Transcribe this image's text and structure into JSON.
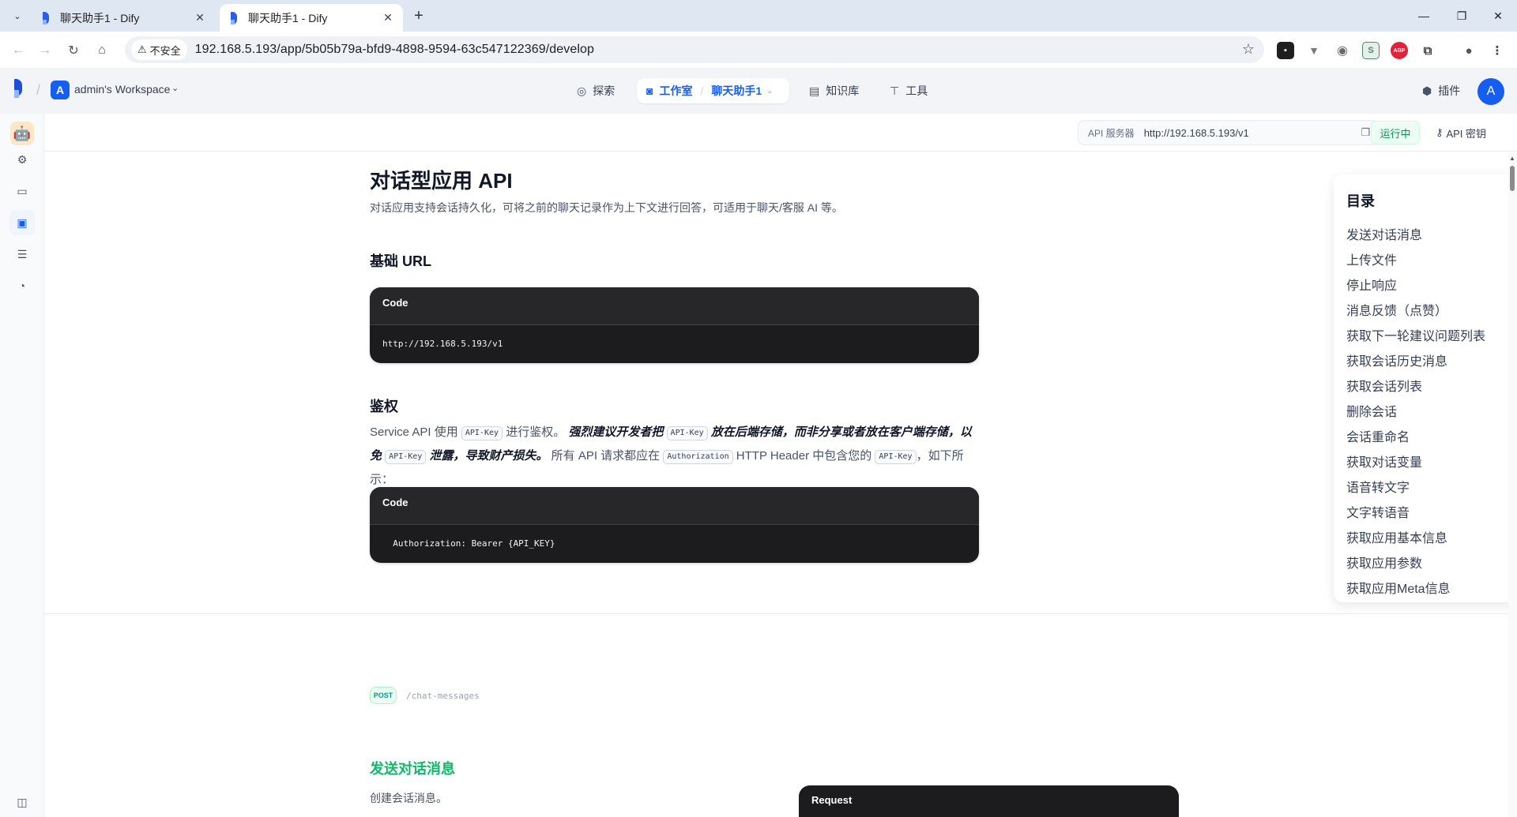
{
  "browser": {
    "tabs": [
      {
        "title": "聊天助手1 - Dify",
        "active": false
      },
      {
        "title": "聊天助手1 - Dify",
        "active": true
      }
    ],
    "security_label": "不安全",
    "url": "192.168.5.193/app/5b05b79a-bfd9-4898-9594-63c547122369/develop",
    "extensions": [
      {
        "icon": "ext-square-icon",
        "color": "#1f1f1f"
      },
      {
        "icon": "ext-v-icon",
        "color": "#7a7a7a"
      },
      {
        "icon": "ext-circle-icon",
        "color": "#6b6b6b"
      },
      {
        "icon": "ext-s-icon",
        "color": "#4c8a6a"
      },
      {
        "icon": "ext-abp-icon",
        "color": "#e0233a",
        "label": "ABP"
      }
    ]
  },
  "header": {
    "workspace_initial": "A",
    "workspace_name": "admin's Workspace",
    "nav": {
      "explore": "探索",
      "studio": "工作室",
      "app_name": "聊天助手1",
      "knowledge": "知识库",
      "tools": "工具",
      "plugins": "插件"
    },
    "user_initial": "A",
    "accent": "#155eef"
  },
  "apibar": {
    "server_label": "API 服务器",
    "server_url": "http://192.168.5.193/v1",
    "status": "运行中",
    "key_button": "API 密钥"
  },
  "doc": {
    "title": "对话型应用 API",
    "description": "对话应用支持会话持久化，可将之前的聊天记录作为上下文进行回答，可适用于聊天/客服 AI 等。",
    "base_url_heading": "基础 URL",
    "code1_label": "Code",
    "code1_body": "http://192.168.5.193/v1",
    "auth_heading": "鉴权",
    "auth": {
      "t1": "Service API 使用 ",
      "k1": "API-Key",
      "t2": " 进行鉴权。 ",
      "b1": "强烈建议开发者把 ",
      "k2": "API-Key",
      "b2": " 放在后端存储，而非分享或者放在客户端存储，以免 ",
      "k3": "API-Key",
      "b3": " 泄露，导致财产损失。",
      "t3": " 所有 API 请求都应在 ",
      "k4": "Authorization",
      "t4": " HTTP Header 中包含您的 ",
      "k5": "API-Key",
      "t5": "，如下所示："
    },
    "code2_label": "Code",
    "code2_body": "  Authorization: Bearer {API_KEY}",
    "method": "POST",
    "path": "/chat-messages",
    "section_title": "发送对话消息",
    "section_desc": "创建会话消息。",
    "request_label": "Request"
  },
  "toc": {
    "title": "目录",
    "items": [
      "发送对话消息",
      "上传文件",
      "停止响应",
      "消息反馈（点赞）",
      "获取下一轮建议问题列表",
      "获取会话历史消息",
      "获取会话列表",
      "删除会话",
      "会话重命名",
      "获取对话变量",
      "语音转文字",
      "文字转语音",
      "获取应用基本信息",
      "获取应用参数",
      "获取应用Meta信息"
    ]
  }
}
